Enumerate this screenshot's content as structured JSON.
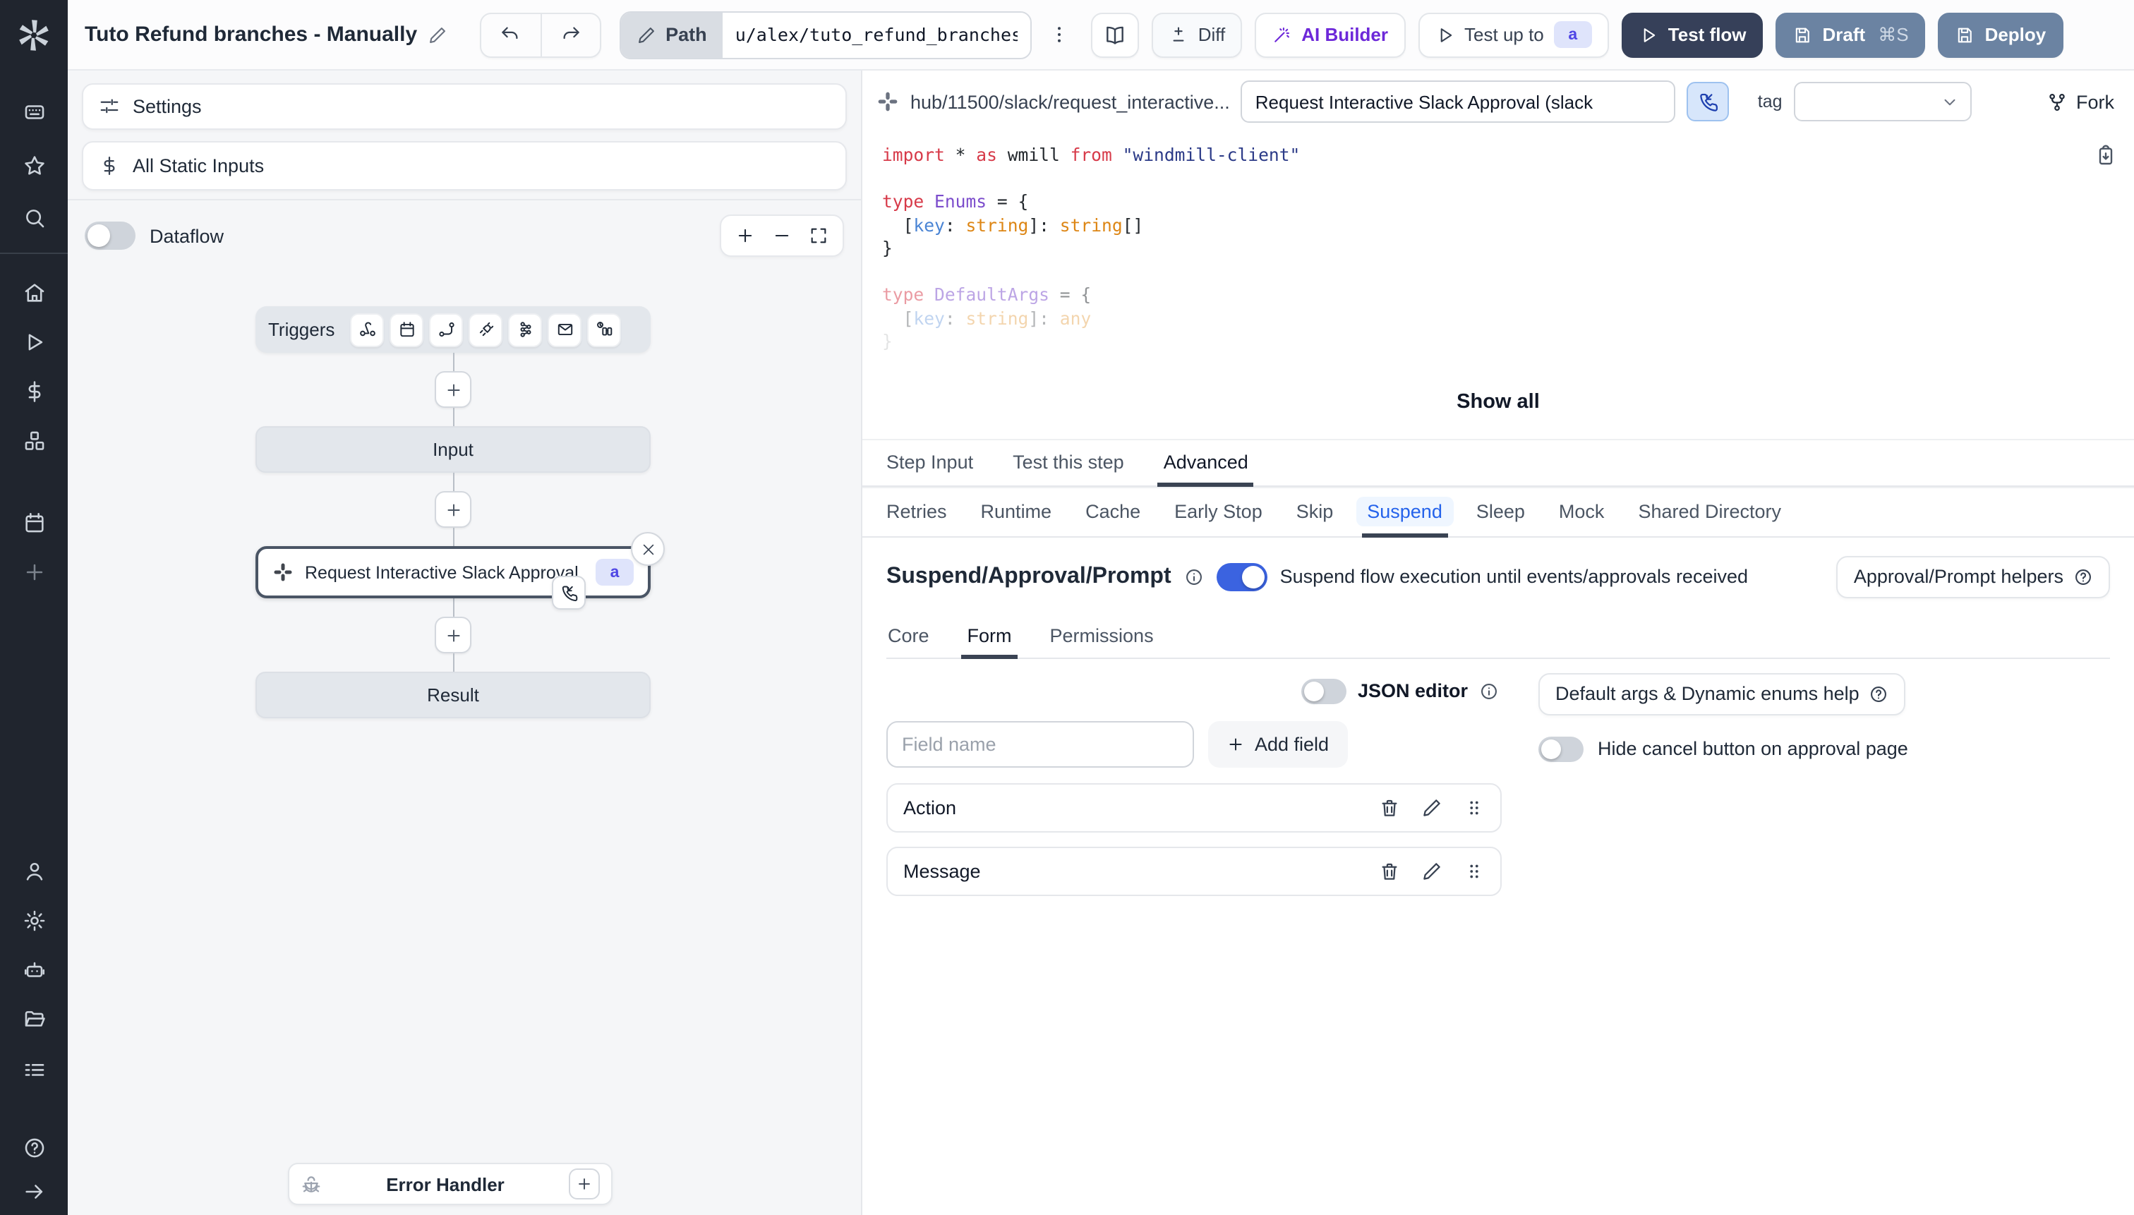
{
  "topbar": {
    "title": "Tuto Refund branches - Manually",
    "path_label": "Path",
    "path_value": "u/alex/tuto_refund_branches_",
    "diff_label": "Diff",
    "ai_builder_label": "AI Builder",
    "test_up_to_label": "Test up to",
    "test_up_to_badge": "a",
    "test_flow_label": "Test flow",
    "draft_label": "Draft",
    "draft_shortcut": "⌘S",
    "deploy_label": "Deploy"
  },
  "flow": {
    "settings_label": "Settings",
    "static_inputs_label": "All Static Inputs",
    "dataflow_label": "Dataflow",
    "triggers_label": "Triggers",
    "input_label": "Input",
    "node_title": "Request Interactive Slack Approval (...",
    "node_badge": "a",
    "result_label": "Result",
    "error_handler_label": "Error Handler"
  },
  "panel": {
    "hub_path": "hub/11500/slack/request_interactive...",
    "script_name": "Request Interactive Slack Approval (slack",
    "tag_label": "tag",
    "fork_label": "Fork",
    "show_all_label": "Show all",
    "code": {
      "line1": {
        "t0": "import",
        "t1": " * ",
        "t2": "as",
        "t3": " wmill ",
        "t4": "from",
        "t5": " \"windmill-client\""
      },
      "line3": {
        "t0": "type",
        "t1": " Enums",
        "t2": " = {"
      },
      "line4": {
        "t0": "  [",
        "t1": "key",
        "t2": ": ",
        "t3": "string",
        "t4": "]: ",
        "t5": "string",
        "t6": "[]"
      },
      "line5": {
        "t0": "}"
      },
      "line7": {
        "t0": "type",
        "t1": " DefaultArgs",
        "t2": " = {"
      },
      "line8": {
        "t0": "  [",
        "t1": "key",
        "t2": ": ",
        "t3": "string",
        "t4": "]: ",
        "t5": "any"
      },
      "line9": {
        "t0": "}"
      }
    },
    "tabs": [
      "Step Input",
      "Test this step",
      "Advanced"
    ],
    "subtabs": [
      "Retries",
      "Runtime",
      "Cache",
      "Early Stop",
      "Skip",
      "Suspend",
      "Sleep",
      "Mock",
      "Shared Directory"
    ],
    "suspend": {
      "heading": "Suspend/Approval/Prompt",
      "toggle_description": "Suspend flow execution until events/approvals received",
      "helpers_label": "Approval/Prompt helpers",
      "form_tabs": [
        "Core",
        "Form",
        "Permissions"
      ],
      "json_editor_label": "JSON editor",
      "field_placeholder": "Field name",
      "add_field_label": "Add field",
      "fields": [
        "Action",
        "Message"
      ],
      "default_args_label": "Default args & Dynamic enums help",
      "hide_cancel_label": "Hide cancel button on approval page"
    }
  },
  "colors": {
    "accent_blue": "#3b63e0",
    "navy_button": "#364059",
    "slate_button": "#6b83a2",
    "badge_bg": "#dfe4fb",
    "badge_text": "#4f46e5",
    "ai_purple": "#6d28d9",
    "sidebar_bg": "#20252e",
    "canvas_bg": "#f5f6f8"
  }
}
